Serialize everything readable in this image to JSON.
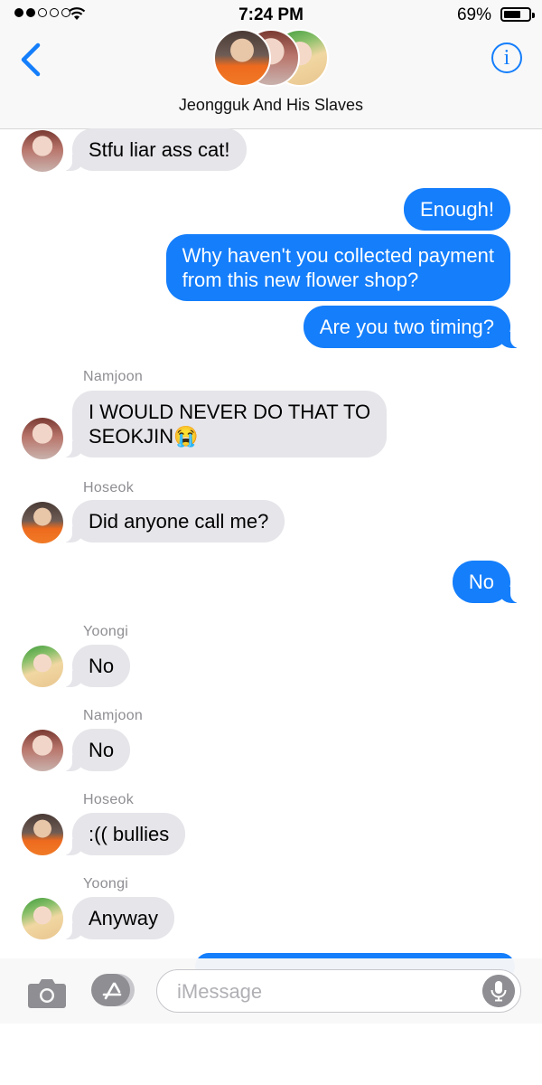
{
  "status_bar": {
    "time": "7:24 PM",
    "battery_percent": "69%",
    "battery_level": 0.69,
    "signal_bars_filled": 2,
    "signal_bars_total": 5
  },
  "header": {
    "group_name": "Jeongguk And His Slaves",
    "info_glyph": "i"
  },
  "messages": [
    {
      "type": "incoming",
      "sender": "",
      "avatar": "jin",
      "text": "Stfu liar ass cat!"
    },
    {
      "type": "outgoing",
      "text": "Enough!"
    },
    {
      "type": "outgoing",
      "text": "Why haven't you collected payment\nfrom this new flower shop?"
    },
    {
      "type": "outgoing",
      "text": "Are you two timing?"
    },
    {
      "type": "incoming",
      "sender": "Namjoon",
      "avatar": "jin",
      "text": "I WOULD NEVER DO THAT TO\nSEOKJIN😭"
    },
    {
      "type": "incoming",
      "sender": "Hoseok",
      "avatar": "hoseok",
      "text": "Did anyone call me?"
    },
    {
      "type": "outgoing",
      "text": "No"
    },
    {
      "type": "incoming",
      "sender": "Yoongi",
      "avatar": "yoongi",
      "text": "No"
    },
    {
      "type": "incoming",
      "sender": "Namjoon",
      "avatar": "jin",
      "text": "No"
    },
    {
      "type": "incoming",
      "sender": "Hoseok",
      "avatar": "hoseok",
      "text": ":(( bullies"
    },
    {
      "type": "incoming",
      "sender": "Yoongi",
      "avatar": "yoongi",
      "text": "Anyway"
    }
  ],
  "input_bar": {
    "placeholder": "iMessage",
    "icons": [
      "camera-icon",
      "app-store-icon",
      "microphone-icon"
    ]
  },
  "colors": {
    "outgoing_bubble": "#147efb",
    "incoming_bubble": "#e5e5ea",
    "accent": "#147efb"
  }
}
